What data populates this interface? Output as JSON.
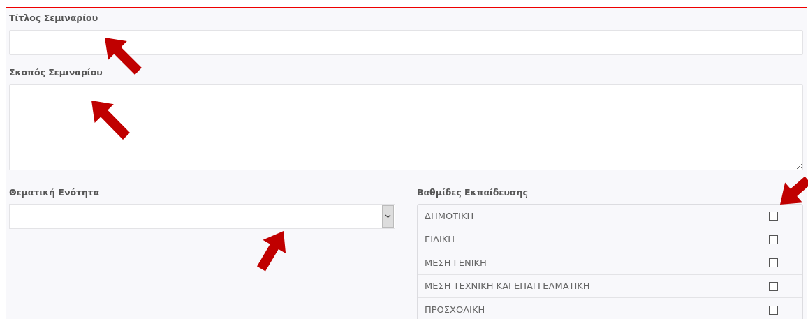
{
  "title_field": {
    "label": "Τίτλος Σεμιναρίου"
  },
  "purpose_field": {
    "label": "Σκοπός Σεμιναρίου"
  },
  "topic_field": {
    "label": "Θεματική Ενότητα"
  },
  "levels": {
    "label": "Βαθμίδες Εκπαίδευσης",
    "options": [
      {
        "label": "ΔΗΜΟΤΙΚΗ",
        "checked": false
      },
      {
        "label": "ΕΙΔΙΚΗ",
        "checked": false
      },
      {
        "label": "ΜΕΣΗ ΓΕΝΙΚΗ",
        "checked": false
      },
      {
        "label": "ΜΕΣΗ ΤΕΧΝΙΚΗ ΚΑΙ ΕΠΑΓΓΕΛΜΑΤΙΚΗ",
        "checked": false
      },
      {
        "label": "ΠΡΟΣΧΟΛΙΚΗ",
        "checked": false
      }
    ]
  }
}
